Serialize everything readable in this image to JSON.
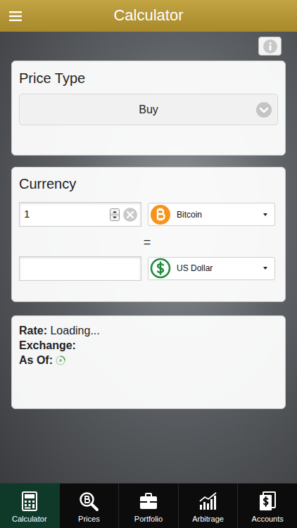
{
  "header": {
    "title": "Calculator"
  },
  "price_type": {
    "label": "Price Type",
    "value": "Buy"
  },
  "currency": {
    "label": "Currency",
    "amount": "1",
    "from": "Bitcoin",
    "equals": "=",
    "result": "",
    "to": "US Dollar"
  },
  "info": {
    "rate_label": "Rate:",
    "rate_value": "Loading...",
    "exchange_label": "Exchange:",
    "as_of_label": "As Of:"
  },
  "tabs": [
    {
      "label": "Calculator",
      "selected": true
    },
    {
      "label": "Prices",
      "selected": false
    },
    {
      "label": "Portfolio",
      "selected": false
    },
    {
      "label": "Arbitrage",
      "selected": false
    },
    {
      "label": "Accounts",
      "selected": false
    }
  ]
}
